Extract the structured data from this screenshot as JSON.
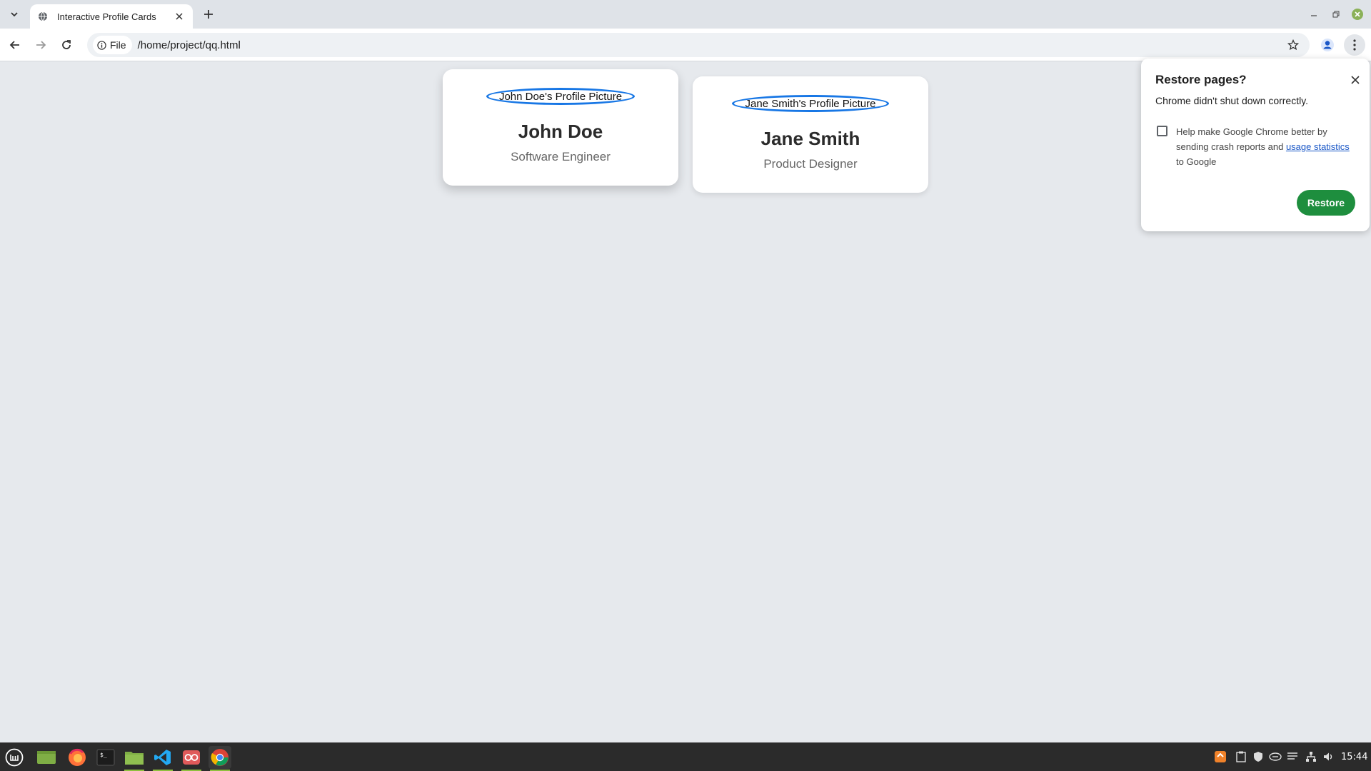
{
  "browser": {
    "tab_title": "Interactive Profile Cards",
    "chip_label": "File",
    "url": "/home/project/qq.html"
  },
  "cards": [
    {
      "avatar_alt": "John Doe's Profile Picture",
      "name": "John Doe",
      "role": "Software Engineer"
    },
    {
      "avatar_alt": "Jane Smith's Profile Picture",
      "name": "Jane Smith",
      "role": "Product Designer"
    }
  ],
  "restore_dialog": {
    "title": "Restore pages?",
    "message": "Chrome didn't shut down correctly.",
    "help_prefix": "Help make Google Chrome better by sending crash reports and ",
    "help_link": "usage statistics",
    "help_suffix": " to Google",
    "button_label": "Restore",
    "checkbox_checked": false
  },
  "taskbar": {
    "clock": "15:44",
    "apps": [
      "mint-menu-icon",
      "show-desktop-icon",
      "firefox-icon",
      "terminal-icon",
      "files-icon",
      "vscode-icon",
      "xreader-icon",
      "chrome-icon"
    ]
  },
  "colors": {
    "accent": "#1877e5",
    "restore_button": "#1e8e3e",
    "page_bg": "#e6e9ed"
  }
}
